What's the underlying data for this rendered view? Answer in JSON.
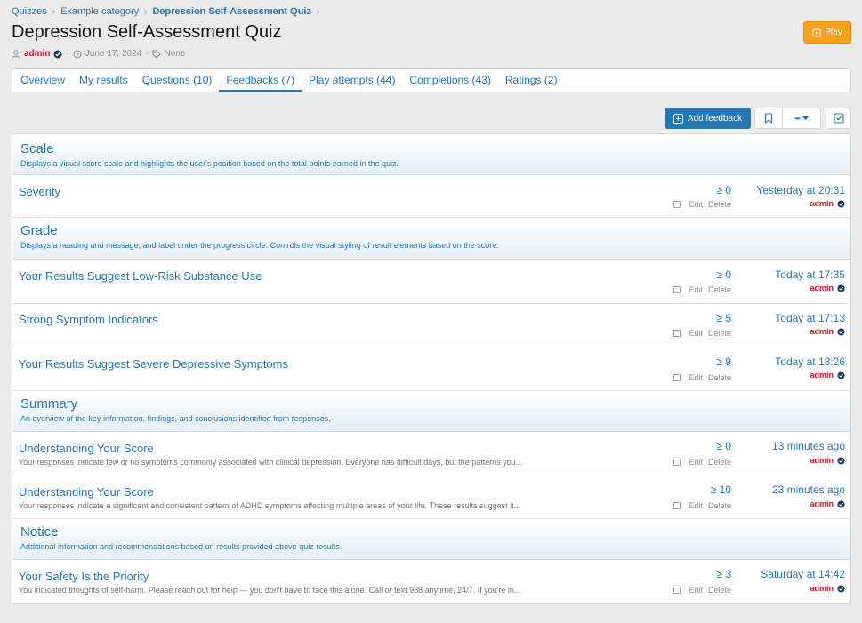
{
  "breadcrumb": [
    "Quizzes",
    "Example category",
    "Depression Self-Assessment Quiz"
  ],
  "title": "Depression Self-Assessment Quiz",
  "meta": {
    "author": "admin",
    "date": "June 17, 2024",
    "tags": "None"
  },
  "play_label": "Play",
  "tabs": [
    "Overview",
    "My results",
    "Questions (10)",
    "Feedbacks (7)",
    "Play attempts (44)",
    "Completions (43)",
    "Ratings (2)"
  ],
  "active_tab": "Feedbacks (7)",
  "toolbar": {
    "add_feedback": "Add feedback",
    "more": "•••"
  },
  "actions": {
    "edit": "Edit",
    "delete": "Delete"
  },
  "groups": [
    {
      "title": "Scale",
      "description": "Displays a visual score scale and highlights the user's position based on the total points earned in the quiz.",
      "items": [
        {
          "title": "Severity",
          "snippet": "",
          "score": "≥ 0",
          "date": "Yesterday at 20:31",
          "user": "admin"
        }
      ]
    },
    {
      "title": "Grade",
      "description": "Displays a heading and message, and label under the progress circle. Controls the visual styling of result elements based on the score.",
      "items": [
        {
          "title": "Your Results Suggest Low-Risk Substance Use",
          "snippet": "",
          "score": "≥ 0",
          "date": "Today at 17:35",
          "user": "admin"
        },
        {
          "title": "Strong Symptom Indicators",
          "snippet": "",
          "score": "≥ 5",
          "date": "Today at 17:13",
          "user": "admin"
        },
        {
          "title": "Your Results Suggest Severe Depressive Symptoms",
          "snippet": "",
          "score": "≥ 9",
          "date": "Today at 18:26",
          "user": "admin"
        }
      ]
    },
    {
      "title": "Summary",
      "description": "An overview of the key information, findings, and conclusions identified from responses.",
      "items": [
        {
          "title": "Understanding Your Score",
          "snippet": "Your responses indicate few or no symptoms commonly associated with clinical depression. Everyone has difficult days, but the patterns you...",
          "score": "≥ 0",
          "date": "13 minutes ago",
          "user": "admin"
        },
        {
          "title": "Understanding Your Score",
          "snippet": "Your responses indicate a significant and consistent pattern of ADHD symptoms affecting multiple areas of your life. These results suggest it...",
          "score": "≥ 10",
          "date": "23 minutes ago",
          "user": "admin"
        }
      ]
    },
    {
      "title": "Notice",
      "description": "Additional information and recommendations based on results provided above quiz results.",
      "items": [
        {
          "title": "Your Safety Is the Priority",
          "snippet": "You indicated thoughts of self-harm. Please reach out for help — you don't have to face this alone. Call or text 988 anytime, 24/7. If you're in...",
          "score": "≥ 3",
          "date": "Saturday at 14:42",
          "user": "admin"
        }
      ]
    }
  ],
  "colors": {
    "link": "#2577b1",
    "author": "#c3142d",
    "play": "#f7a21b",
    "primary_button": "#2577b1"
  }
}
